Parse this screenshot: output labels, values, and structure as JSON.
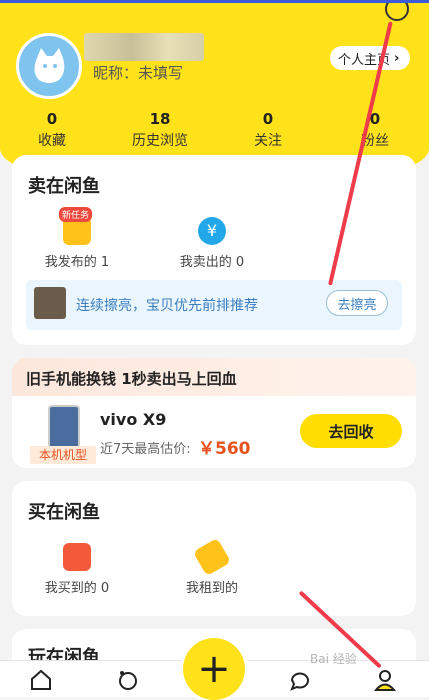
{
  "header": {
    "nickname": "昵称：未填写",
    "profile_button": "个人主页",
    "stats": [
      {
        "value": "0",
        "label": "收藏"
      },
      {
        "value": "18",
        "label": "历史浏览"
      },
      {
        "value": "0",
        "label": "关注"
      },
      {
        "value": "0",
        "label": "粉丝"
      }
    ]
  },
  "sell": {
    "title": "卖在闲鱼",
    "badge": "新任务",
    "published": "我发布的 1",
    "sold": "我卖出的 0",
    "promo_text": "连续擦亮，宝贝优先前排推荐",
    "promo_button": "去擦亮"
  },
  "recycle": {
    "title": "旧手机能换钱 1秒卖出马上回血",
    "model": "vivo X9",
    "tag": "本机机型",
    "estimate_label": "近7天最高估价:",
    "estimate_price": "￥560",
    "button": "去回收"
  },
  "buy": {
    "title": "买在闲鱼",
    "bought": "我买到的 0",
    "rented": "我租到的"
  },
  "play": {
    "title": "玩在闲鱼"
  },
  "watermark": "Bai 经验"
}
